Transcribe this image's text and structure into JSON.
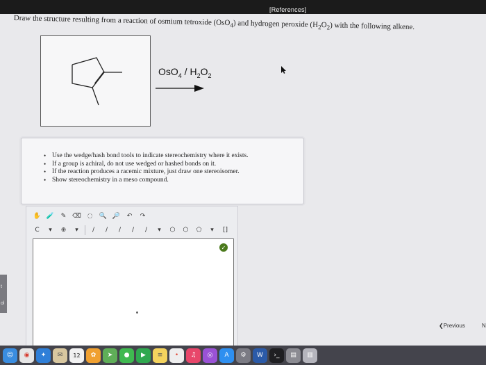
{
  "header": {
    "references_label": "[References]"
  },
  "question": {
    "prefix": "Draw the structure resulting from a reaction of osmium tetroxide (OsO",
    "s1": "4",
    "mid": ") and hydrogen peroxide (H",
    "s2": "2",
    "o": "O",
    "s3": "2",
    "suffix": ") with the following alkene."
  },
  "reaction": {
    "reagent_os": "OsO",
    "reagent_os_sub": "4",
    "reagent_sep": " / H",
    "reagent_h_sub": "2",
    "reagent_o": "O",
    "reagent_o_sub": "2"
  },
  "instructions": [
    "Use the wedge/hash bond tools to indicate stereochemistry where it exists.",
    "If a group is achiral, do not use wedged or hashed bonds on it.",
    "If the reaction produces a racemic mixture, just draw one stereoisomer.",
    "Show stereochemistry in a meso compound."
  ],
  "toolbar": {
    "row1": [
      "hand-icon",
      "bottle-icon",
      "pencil-icon",
      "eraser-icon",
      "lasso-icon",
      "zoom-in-icon",
      "zoom-out-icon",
      "undo-icon",
      "redo-icon"
    ],
    "row1_glyphs": [
      "✋",
      "🧪",
      "✎",
      "⌫",
      "◌",
      "🔍",
      "🔎",
      "↶",
      "↷"
    ],
    "row2_labels": [
      "C",
      "▾",
      "⊕",
      "▾",
      "/",
      "/",
      "/",
      "/",
      "/",
      "▾",
      "⬡",
      "⬡",
      "⬠",
      "▾",
      "[]"
    ]
  },
  "editor": {
    "check_glyph": "✓"
  },
  "nav": {
    "previous_label": "Previous",
    "next_label": "N"
  },
  "left_strip": [
    "t",
    "ol"
  ],
  "dock": {
    "calendar_day": "12",
    "icons": [
      "finder-icon",
      "chrome-icon",
      "safari-icon",
      "mail-icon",
      "calendar-icon",
      "photos-icon",
      "maps-icon",
      "messages-icon",
      "facetime-icon",
      "notes-icon",
      "reminders-icon",
      "music-icon",
      "podcasts-icon",
      "appstore-icon",
      "settings-icon",
      "word-icon",
      "terminal-icon",
      "files-icon",
      "trash-icon"
    ]
  }
}
